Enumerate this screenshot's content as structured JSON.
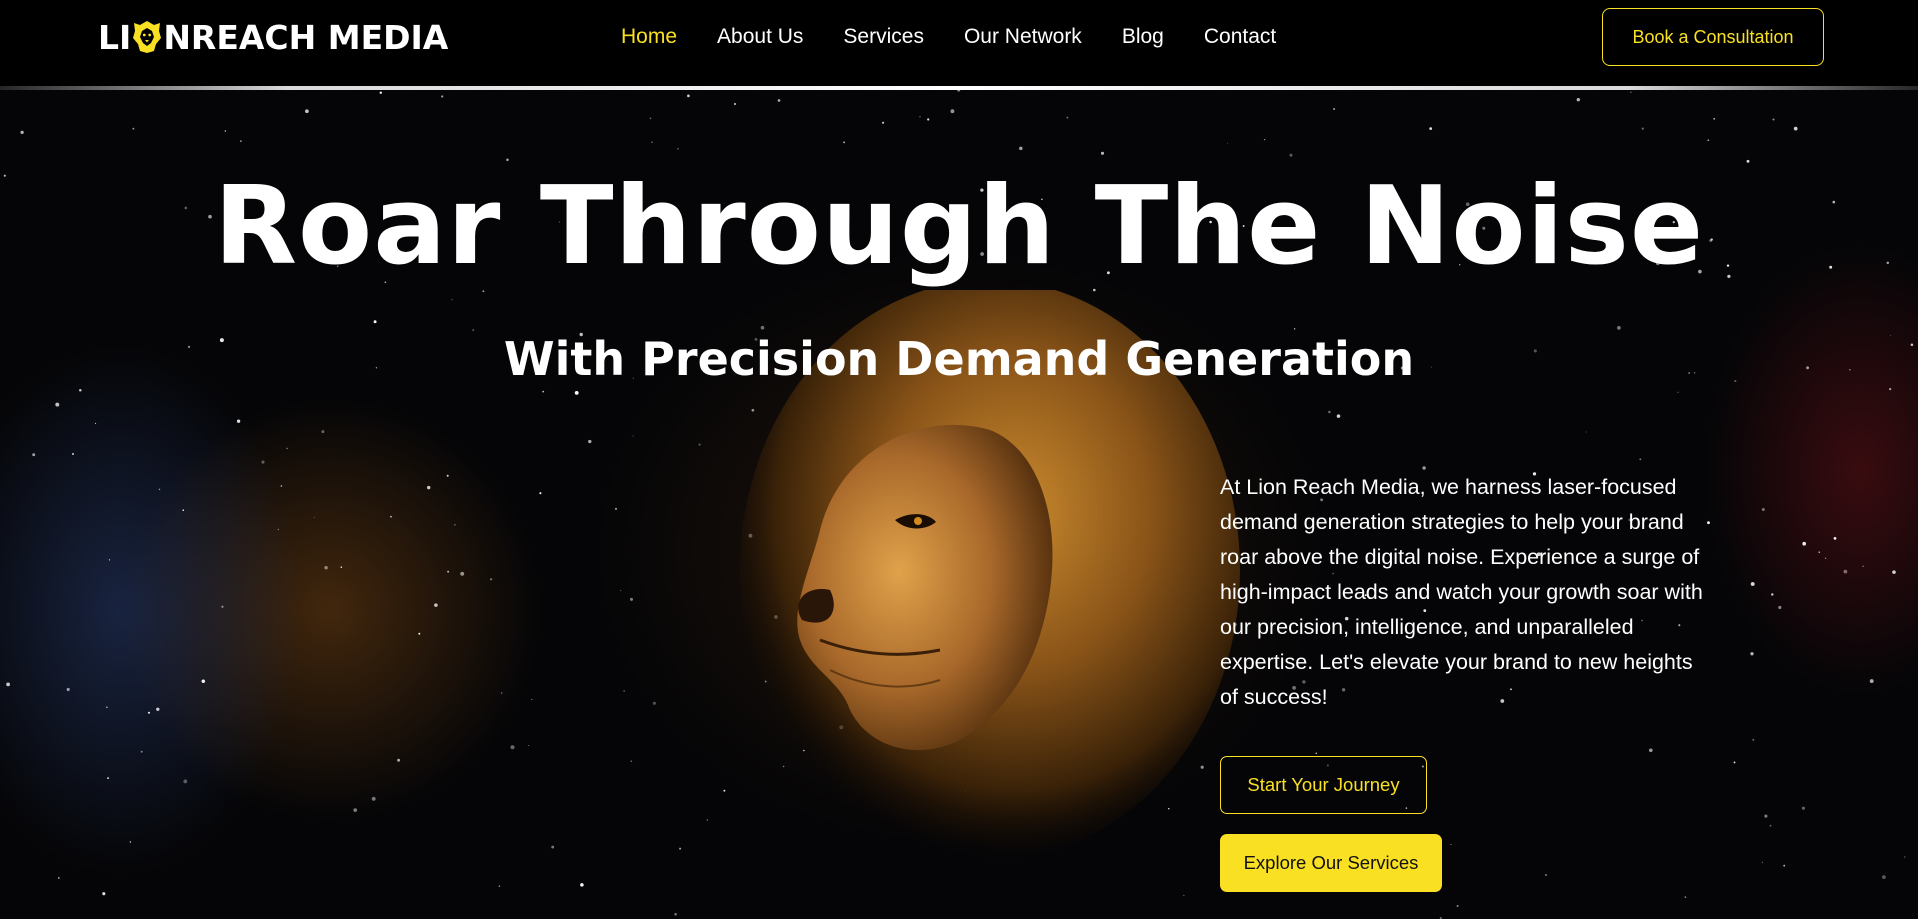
{
  "brand": {
    "logo_part1": "LI",
    "logo_part2": "NREACH MEDIA",
    "logo_icon": "lion-head-icon",
    "accent_color": "#f9e023"
  },
  "nav": {
    "items": [
      {
        "label": "Home",
        "active": true
      },
      {
        "label": "About Us",
        "active": false
      },
      {
        "label": "Services",
        "active": false
      },
      {
        "label": "Our Network",
        "active": false
      },
      {
        "label": "Blog",
        "active": false
      },
      {
        "label": "Contact",
        "active": false
      }
    ],
    "cta_label": "Book a Consultation"
  },
  "hero": {
    "title": "Roar Through The Noise",
    "subtitle": "With Precision Demand Generation",
    "description": "At Lion Reach Media, we harness laser-focused demand generation strategies to help your brand roar above the digital noise. Experience a surge of high-impact leads and watch your growth soar with our precision, intelligence, and unparalleled expertise. Let's elevate your brand to new heights of success!",
    "primary_button": "Start Your Journey",
    "secondary_button": "Explore Our Services",
    "background_image": "lion-in-starry-space"
  }
}
